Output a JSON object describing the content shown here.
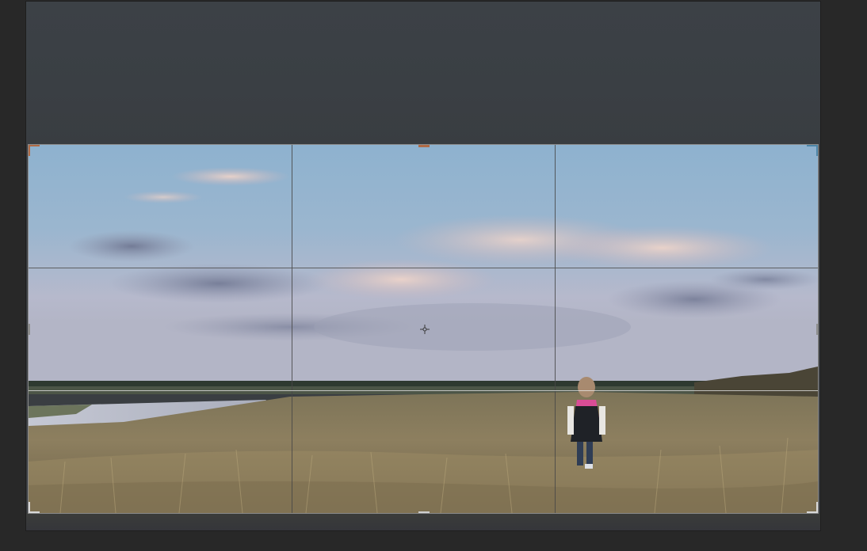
{
  "app": {
    "view": "crop-tool",
    "overlay": "rule-of-thirds"
  },
  "colors": {
    "workspace_bg": "#282828",
    "mask": "#3a3e42",
    "handle_accent": "#b06b46",
    "handle_right": "#4d86a8",
    "grid_line": "#464646"
  },
  "icons": {
    "center": "crosshair-icon"
  }
}
